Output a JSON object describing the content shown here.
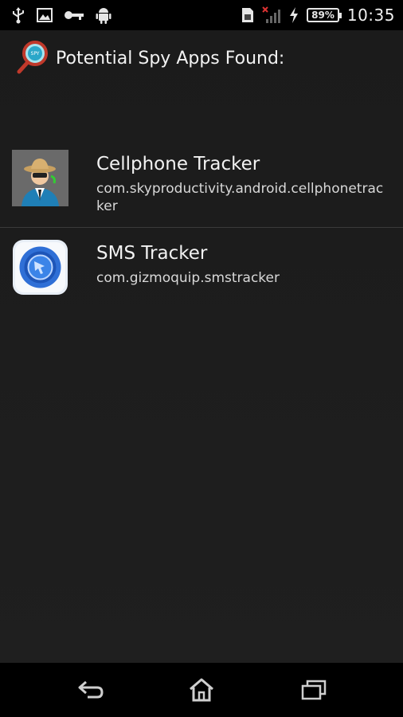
{
  "status_bar": {
    "left_icons": [
      "usb-icon",
      "image-icon",
      "key-icon",
      "android-icon"
    ],
    "right_icons": [
      "sim-icon",
      "no-signal-icon",
      "charging-icon"
    ],
    "battery": "89%",
    "time": "10:35"
  },
  "header": {
    "icon": "magnifier-spy-icon",
    "title": "Potential Spy Apps Found:"
  },
  "apps": [
    {
      "name": "Cellphone Tracker",
      "package": "com.skyproductivity.android.cellphonetracker",
      "icon": "spy-agent-icon"
    },
    {
      "name": "SMS Tracker",
      "package": "com.gizmoquip.smstracker",
      "icon": "sms-tracker-icon"
    }
  ],
  "nav_bar": {
    "icons": [
      "back-icon",
      "home-icon",
      "recents-icon"
    ]
  },
  "colors": {
    "background": "#1c1c1c",
    "text": "#f2f2f2",
    "divider": "#3a3a3a"
  }
}
